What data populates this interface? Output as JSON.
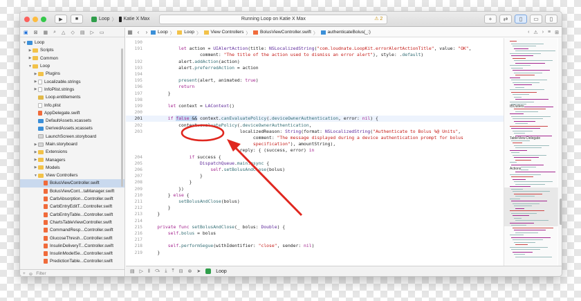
{
  "toolbar": {
    "scheme_app": "Loop",
    "scheme_device": "Katie X Max",
    "activity_status": "Running Loop on Katie X Max",
    "warning_count": "2"
  },
  "navigator": {
    "filter_placeholder": "Filter",
    "items": [
      {
        "label": "Loop",
        "icon": "project-icon",
        "depth": 0,
        "disclosure": "open"
      },
      {
        "label": "Scripts",
        "icon": "folder-icon",
        "depth": 1,
        "disclosure": "closed"
      },
      {
        "label": "Common",
        "icon": "folder-icon",
        "depth": 1,
        "disclosure": "closed"
      },
      {
        "label": "Loop",
        "icon": "folder-icon",
        "depth": 1,
        "disclosure": "open"
      },
      {
        "label": "Plugins",
        "icon": "folder-icon",
        "depth": 2,
        "disclosure": "closed"
      },
      {
        "label": "Localizable.strings",
        "icon": "file-icon",
        "depth": 2,
        "disclosure": "closed"
      },
      {
        "label": "InfoPlist.strings",
        "icon": "file-icon",
        "depth": 2,
        "disclosure": "closed"
      },
      {
        "label": "Loop.entitlements",
        "icon": "entitlements-icon",
        "depth": 2,
        "disclosure": "none"
      },
      {
        "label": "Info.plist",
        "icon": "file-icon",
        "depth": 2,
        "disclosure": "none"
      },
      {
        "label": "AppDelegate.swift",
        "icon": "swift-icon",
        "depth": 2,
        "disclosure": "none"
      },
      {
        "label": "DefaultAssets.xcassets",
        "icon": "assets-icon",
        "depth": 2,
        "disclosure": "none"
      },
      {
        "label": "DerivedAssets.xcassets",
        "icon": "assets-icon",
        "depth": 2,
        "disclosure": "none"
      },
      {
        "label": "LaunchScreen.storyboard",
        "icon": "storyboard-icon",
        "depth": 2,
        "disclosure": "none"
      },
      {
        "label": "Main.storyboard",
        "icon": "storyboard-icon",
        "depth": 2,
        "disclosure": "closed"
      },
      {
        "label": "Extensions",
        "icon": "folder-icon",
        "depth": 2,
        "disclosure": "closed"
      },
      {
        "label": "Managers",
        "icon": "folder-icon",
        "depth": 2,
        "disclosure": "closed"
      },
      {
        "label": "Models",
        "icon": "folder-icon",
        "depth": 2,
        "disclosure": "closed"
      },
      {
        "label": "View Controllers",
        "icon": "folder-icon",
        "depth": 2,
        "disclosure": "open"
      },
      {
        "label": "BolusViewController.swift",
        "icon": "swift-icon",
        "depth": 3,
        "disclosure": "none",
        "selected": true
      },
      {
        "label": "BolusViewCont...taManager.swift",
        "icon": "swift-icon",
        "depth": 3,
        "disclosure": "none"
      },
      {
        "label": "CarbAbsorption...Controller.swift",
        "icon": "swift-icon",
        "depth": 3,
        "disclosure": "none"
      },
      {
        "label": "CarbEntryEditT...Controller.swift",
        "icon": "swift-icon",
        "depth": 3,
        "disclosure": "none"
      },
      {
        "label": "CarbEntryTable...Controller.swift",
        "icon": "swift-icon",
        "depth": 3,
        "disclosure": "none"
      },
      {
        "label": "ChartsTableViewController.swift",
        "icon": "swift-icon",
        "depth": 3,
        "disclosure": "none"
      },
      {
        "label": "CommandResp...Controller.swift",
        "icon": "swift-icon",
        "depth": 3,
        "disclosure": "none"
      },
      {
        "label": "GlucoseThresh...Controller.swift",
        "icon": "swift-icon",
        "depth": 3,
        "disclosure": "none"
      },
      {
        "label": "InsulinDeliveryT...Controller.swift",
        "icon": "swift-icon",
        "depth": 3,
        "disclosure": "none"
      },
      {
        "label": "InsulinModelSe...Controller.swift",
        "icon": "swift-icon",
        "depth": 3,
        "disclosure": "none"
      },
      {
        "label": "PredictionTable...Controller.swift",
        "icon": "swift-icon",
        "depth": 3,
        "disclosure": "none"
      }
    ]
  },
  "jumpbar": {
    "crumbs": [
      "Loop",
      "Loop",
      "View Controllers",
      "BolusViewController.swift",
      "authenticateBolus(_:)"
    ]
  },
  "editor": {
    "lines": [
      {
        "num": "190",
        "text": ""
      },
      {
        "num": "191",
        "html": "            <span class=\"kw\">let</span> action = <span class=\"typ\">UIAlertAction</span>(title: <span class=\"typ\">NSLocalizedString</span>(<span class=\"str\">\"com.loudnate.LoopKit.errorAlertActionTitle\"</span>, value: <span class=\"str\">\"OK\"</span>,"
      },
      {
        "num": "",
        "html": "                    comment: <span class=\"str\">\"The title of the action used to dismiss an error alert\"</span>), style: .<span class=\"call\">default</span>)"
      },
      {
        "num": "192",
        "html": "            alert.<span class=\"call\">addAction</span>(action)"
      },
      {
        "num": "193",
        "html": "            alert.<span class=\"call\">preferredAction</span> = action"
      },
      {
        "num": "194",
        "text": ""
      },
      {
        "num": "195",
        "html": "            <span class=\"call\">present</span>(alert, animated: <span class=\"kw\">true</span>)"
      },
      {
        "num": "196",
        "html": "            <span class=\"kw\">return</span>"
      },
      {
        "num": "197",
        "html": "        }"
      },
      {
        "num": "198",
        "text": ""
      },
      {
        "num": "199",
        "html": "        <span class=\"kw\">let</span> context = <span class=\"typ\">LAContext</span>()"
      },
      {
        "num": "200",
        "text": ""
      },
      {
        "num": "201",
        "current": true,
        "html": "        <span class=\"kw\">if</span> <span class=\"hl\"><span class=\"kw\">false</span> &amp;&amp;</span> context.<span class=\"call\">canEvaluatePolicy</span>(.<span class=\"call\">deviceOwnerAuthentication</span>, error: <span class=\"kw\">nil</span>) {"
      },
      {
        "num": "202",
        "html": "            context.<span class=\"call\">evaluatePolicy</span>(.<span class=\"call\">deviceOwnerAuthentication</span>,"
      },
      {
        "num": "203",
        "html": "                                   localizedReason: <span class=\"typ\">String</span>(format: <span class=\"typ\">NSLocalizedString</span>(<span class=\"str\">\"Authenticate to Bolus %@ Units\"</span>,"
      },
      {
        "num": "",
        "html": "                                        comment: <span class=\"str\">\"The message displayed during a device authentication prompt for bolus</span>"
      },
      {
        "num": "",
        "html": "                                        <span class=\"str\">specification\"</span>), amountString),"
      },
      {
        "num": "",
        "html": "                                   reply: { (success, error) <span class=\"kw\">in</span>"
      },
      {
        "num": "204",
        "html": "                <span class=\"kw\">if</span> success {"
      },
      {
        "num": "205",
        "html": "                    <span class=\"typ\">DispatchQueue</span>.<span class=\"call\">main</span>.<span class=\"call\">async</span> {"
      },
      {
        "num": "206",
        "html": "                        <span class=\"kw\">self</span>.<span class=\"call\">setBolusAndClose</span>(bolus)"
      },
      {
        "num": "207",
        "html": "                    }"
      },
      {
        "num": "208",
        "html": "                }"
      },
      {
        "num": "209",
        "html": "            })"
      },
      {
        "num": "210",
        "html": "        } <span class=\"kw\">else</span> {"
      },
      {
        "num": "211",
        "html": "            <span class=\"call\">setBolusAndClose</span>(bolus)"
      },
      {
        "num": "212",
        "html": "        }"
      },
      {
        "num": "213",
        "html": "    }"
      },
      {
        "num": "214",
        "text": ""
      },
      {
        "num": "215",
        "html": "    <span class=\"kw\">private func</span> <span class=\"call\">setBolusAndClose</span>(_ bolus: <span class=\"typ\">Double</span>) {"
      },
      {
        "num": "216",
        "html": "        <span class=\"kw\">self</span>.<span class=\"call\">bolus</span> = bolus"
      },
      {
        "num": "217",
        "text": ""
      },
      {
        "num": "218",
        "html": "        <span class=\"kw\">self</span>.<span class=\"call\">performSegue</span>(withIdentifier: <span class=\"str\">\"close\"</span>, sender: <span class=\"kw\">nil</span>)"
      },
      {
        "num": "219",
        "html": "    }"
      }
    ]
  },
  "minimap": {
    "labels": [
      "IBOutlets",
      "TableView Delegate",
      "Actions"
    ]
  },
  "debug": {
    "target": "Loop"
  },
  "colors": {
    "annotation": "#e0271f",
    "selection": "#c9d9ee",
    "keyword": "#a3238e",
    "string": "#c41a16"
  }
}
